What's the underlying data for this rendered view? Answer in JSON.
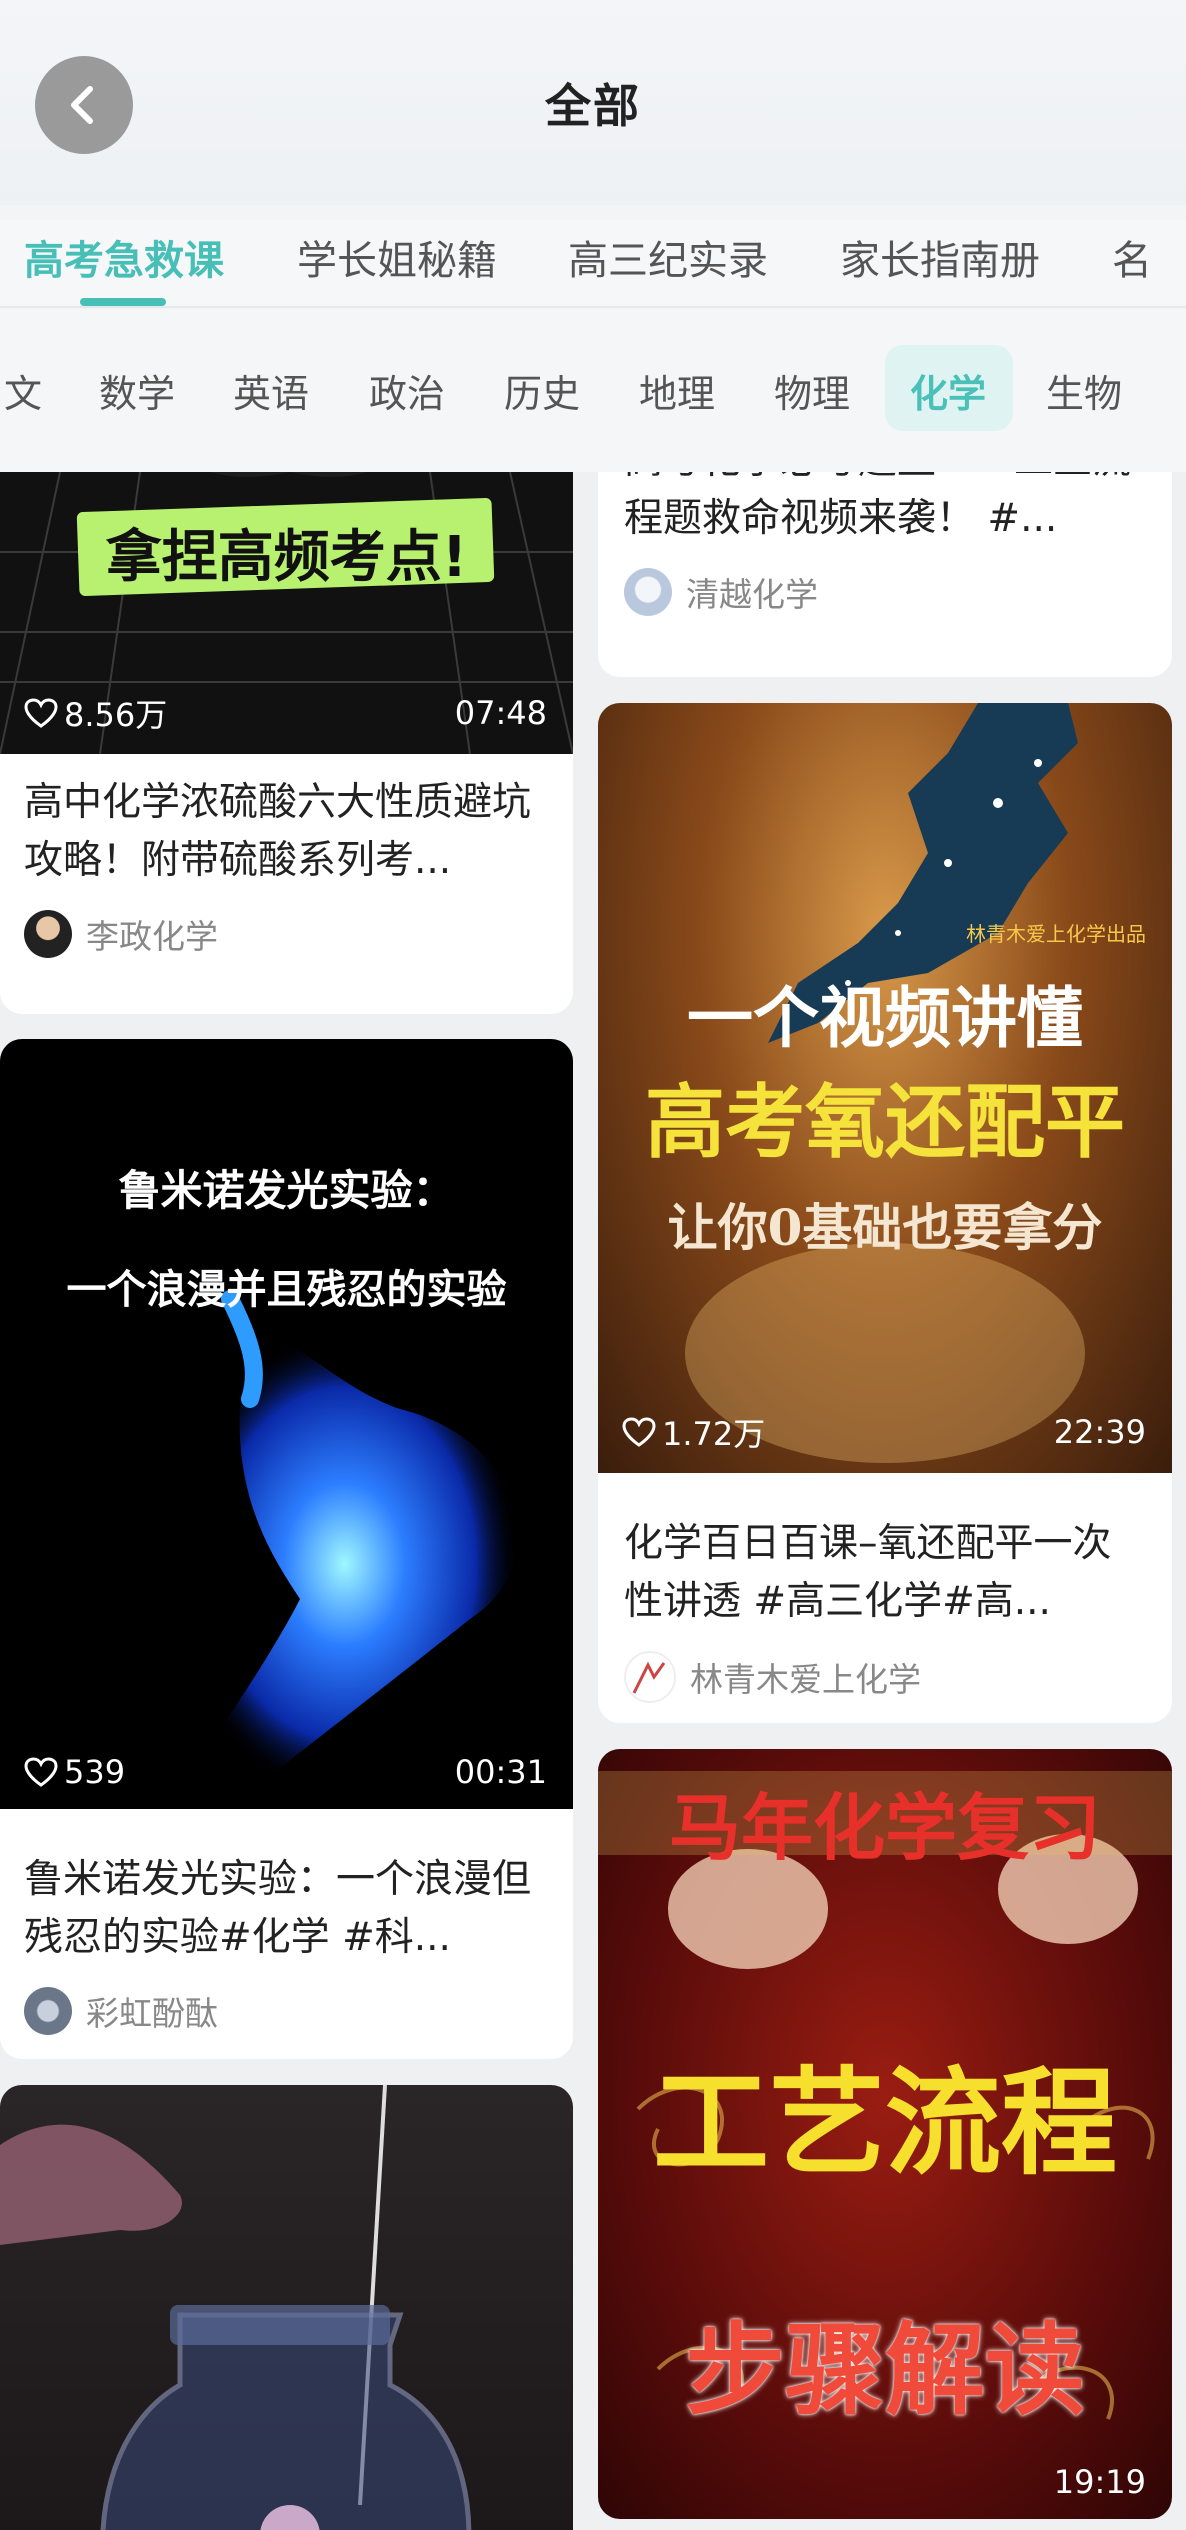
{
  "header": {
    "title": "全部",
    "category_tabs": [
      "高考急救课",
      "学长姐秘籍",
      "高三纪实录",
      "家长指南册",
      "名"
    ],
    "active_category": "高考急救课"
  },
  "subjects": {
    "tabs": [
      "文",
      "数学",
      "英语",
      "政治",
      "历史",
      "地理",
      "物理",
      "化学",
      "生物"
    ],
    "active": "化学"
  },
  "colors": {
    "accent": "#47bfb7",
    "accent_bg": "#dff4f2"
  },
  "cards": {
    "c1": {
      "thumb_text": "拿捏高频考点!",
      "likes": "8.56万",
      "duration": "07:48",
      "title": "高中化学浓硫酸六大性质避坑攻略！附带硫酸系列考...",
      "author": "李政化学"
    },
    "c2": {
      "title": "高考化学必考题型——工业流程题救命视频来袭！ #...",
      "author": "清越化学"
    },
    "c3": {
      "thumb_line1": "鲁米诺发光实验：",
      "thumb_line2": "一个浪漫并且残忍的实验",
      "likes": "539",
      "duration": "00:31",
      "title": "鲁米诺发光实验：一个浪漫但残忍的实验#化学 #科...",
      "author": "彩虹酚酞"
    },
    "c4": {
      "thumb_brand": "林青木爱上化学出品",
      "thumb_line1": "一个视频讲懂",
      "thumb_line2": "高考氧还配平",
      "thumb_line3": "让你0基础也要拿分",
      "likes": "1.72万",
      "duration": "22:39",
      "title": "化学百日百课–氧还配平一次性讲透 #高三化学#高...",
      "author": "林青木爱上化学"
    },
    "c5": {},
    "c6": {
      "thumb_line1": "马年化学复习",
      "thumb_line2": "工艺流程",
      "thumb_line3": "步骤解读",
      "duration": "19:19"
    }
  }
}
